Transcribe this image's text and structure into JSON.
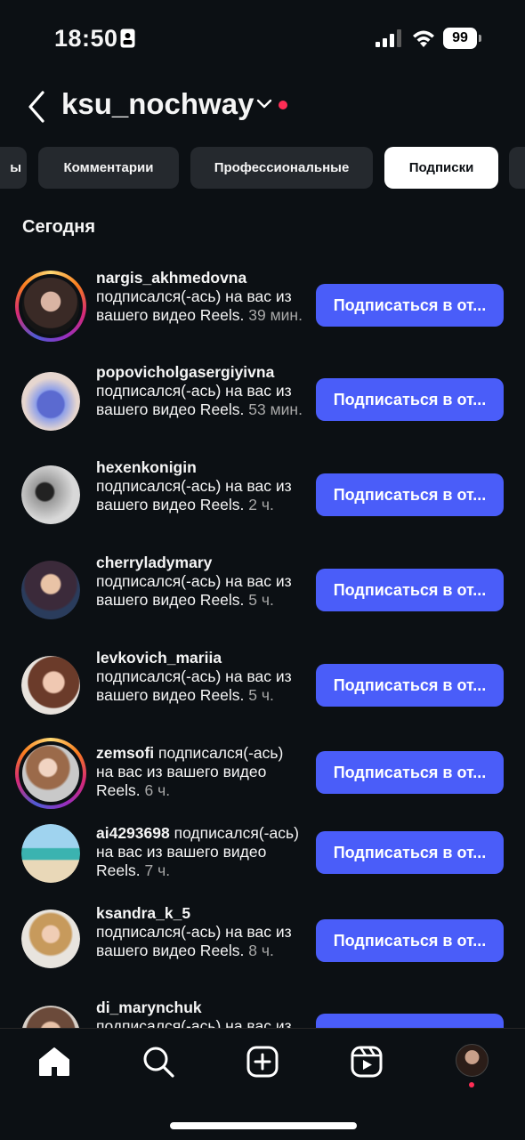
{
  "status": {
    "time": "18:50",
    "battery": "99"
  },
  "header": {
    "username": "ksu_nochway"
  },
  "tabs": [
    {
      "label": "Комментарии"
    },
    {
      "label": "Профессиональные"
    },
    {
      "label": "Подписки"
    }
  ],
  "section": {
    "title": "Сегодня"
  },
  "notifications": [
    {
      "username": "nargis_akhmedovna",
      "text": "подписался(-ась) на вас из вашего видео Reels.",
      "time": "39 мин.",
      "button": "Подписаться в ответ",
      "button_display": "Подписаться в от..."
    },
    {
      "username": "popovicholgasergiyivna",
      "text": "подписался(-ась) на вас из вашего видео Reels.",
      "time": "53 мин.",
      "button": "Подписаться в ответ",
      "button_display": "Подписаться в от..."
    },
    {
      "username": "hexenkonigin",
      "text": "подписался(-ась) на вас из вашего видео Reels.",
      "time": "2 ч.",
      "button": "Подписаться в ответ",
      "button_display": "Подписаться в от..."
    },
    {
      "username": "cherryladymary",
      "text": "подписался(-ась) на вас из вашего видео Reels.",
      "time": "5 ч.",
      "button": "Подписаться в ответ",
      "button_display": "Подписаться в от..."
    },
    {
      "username": "levkovich_mariia",
      "text": "подписался(-ась) на вас из вашего видео Reels.",
      "time": "5 ч.",
      "button": "Подписаться в ответ",
      "button_display": "Подписаться в от..."
    },
    {
      "username": "zemsofi",
      "text": "подписался(-ась) на вас из вашего видео Reels.",
      "time": "6 ч.",
      "button": "Подписаться в ответ",
      "button_display": "Подписаться в от..."
    },
    {
      "username": "ai4293698",
      "text": "подписался(-ась) на вас из вашего видео Reels.",
      "time": "7 ч.",
      "button": "Подписаться в ответ",
      "button_display": "Подписаться в от..."
    },
    {
      "username": "ksandra_k_5",
      "text": "подписался(-ась) на вас из вашего видео Reels.",
      "time": "8 ч.",
      "button": "Подписаться в ответ",
      "button_display": "Подписаться в от..."
    },
    {
      "username": "di_marynchuk",
      "text": "подписался(-ась) на вас из вашего видео Reels.",
      "time": "",
      "button": "Подписаться в ответ",
      "button_display": "Подписаться в от..."
    }
  ],
  "tabbar": {
    "items": [
      {
        "icon": "home-icon"
      },
      {
        "icon": "search-icon"
      },
      {
        "icon": "create-icon"
      },
      {
        "icon": "reels-icon"
      },
      {
        "icon": "profile-avatar"
      }
    ]
  },
  "colors": {
    "background": "#0c1014",
    "accent": "#4a5df9",
    "badge": "#ff2d55"
  }
}
